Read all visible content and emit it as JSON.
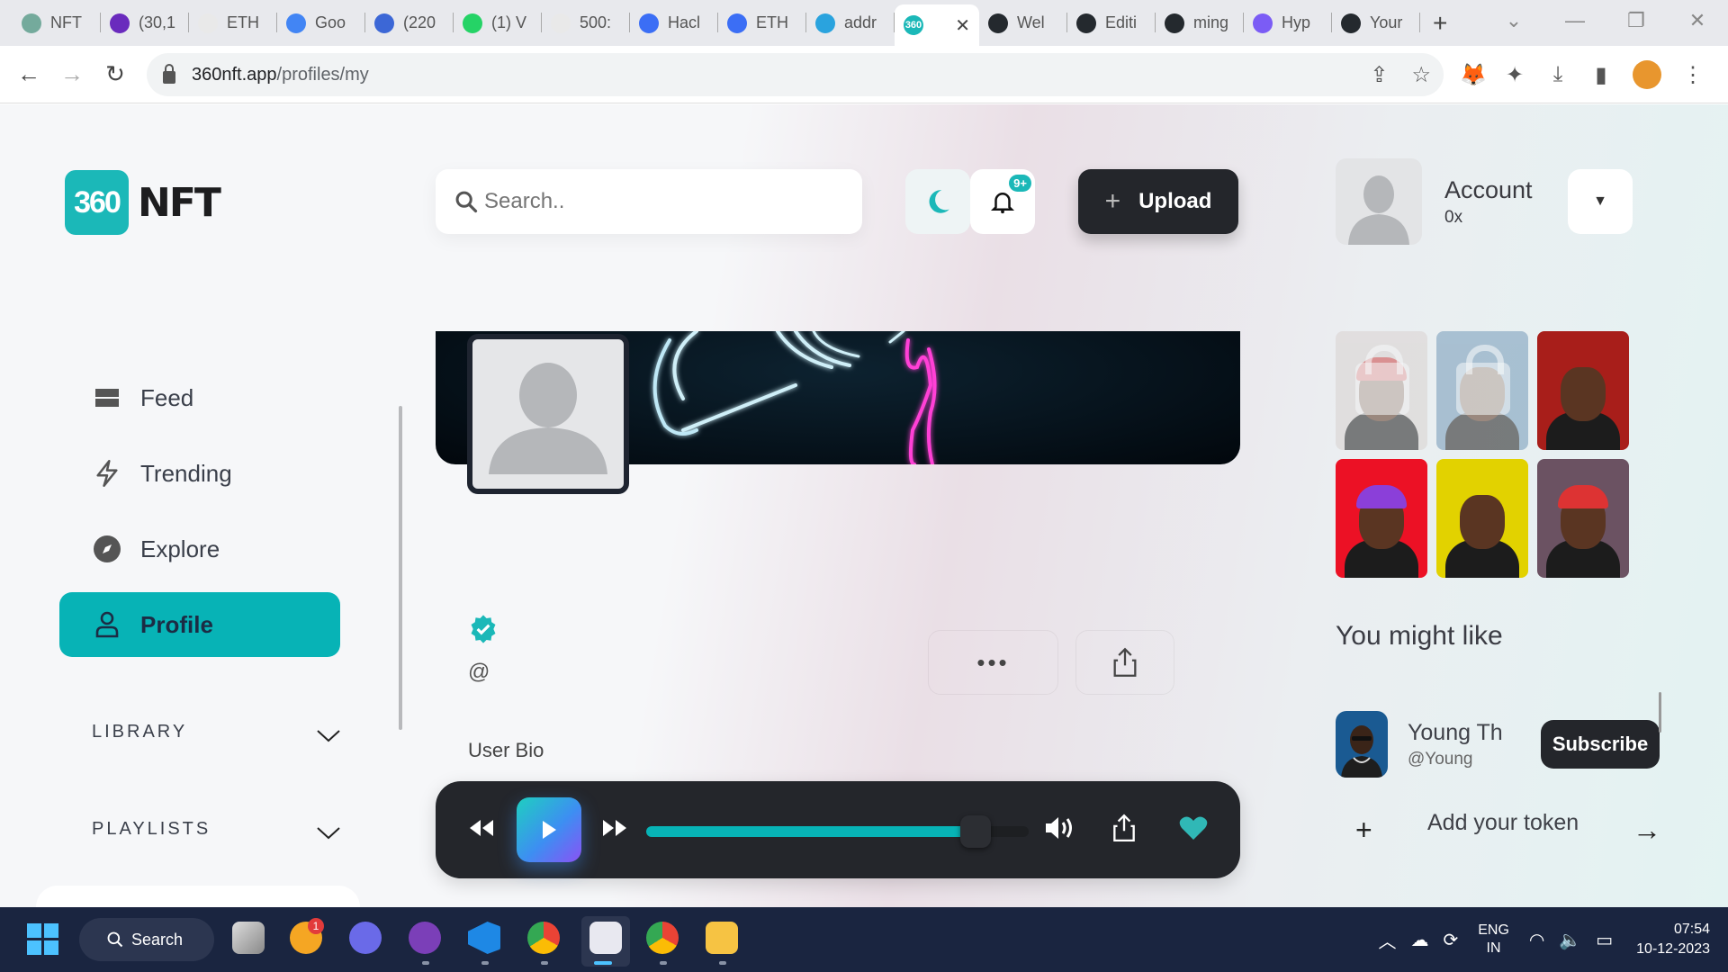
{
  "browser": {
    "tabs": [
      {
        "title": "NFT",
        "icon": "chatgpt-icon",
        "color": "#74aa9c"
      },
      {
        "title": "(30,1",
        "icon": "mail-icon",
        "color": "#6a2bbd"
      },
      {
        "title": "ETH",
        "icon": "eth-icon",
        "color": "#e9e9e9"
      },
      {
        "title": "Goo",
        "icon": "docs-icon",
        "color": "#4285f4"
      },
      {
        "title": "(220",
        "icon": "notification-icon",
        "color": "#3c67d6"
      },
      {
        "title": "(1) V",
        "icon": "whatsapp-icon",
        "color": "#25d366"
      },
      {
        "title": "500:",
        "icon": "eth-icon",
        "color": "#e9e9e9"
      },
      {
        "title": "Hacl",
        "icon": "doc-icon",
        "color": "#3b6ef5"
      },
      {
        "title": "ETH",
        "icon": "doc-icon",
        "color": "#3b6ef5"
      },
      {
        "title": "addr",
        "icon": "telegram-icon",
        "color": "#2aa3de"
      },
      {
        "title": "",
        "icon": "360nft-icon",
        "color": "#1bb8b8",
        "active": true
      },
      {
        "title": "Wel",
        "icon": "github-icon",
        "color": "#24292e"
      },
      {
        "title": "Editi",
        "icon": "github-icon",
        "color": "#24292e"
      },
      {
        "title": "ming",
        "icon": "github-icon",
        "color": "#24292e"
      },
      {
        "title": "Hyp",
        "icon": "hyper-icon",
        "color": "#7b5cf5"
      },
      {
        "title": "Your",
        "icon": "github-icon",
        "color": "#24292e"
      }
    ],
    "url_host": "360nft.app",
    "url_path": "/profiles/my"
  },
  "header": {
    "logo_number": "360",
    "logo_word": "NFT",
    "search_placeholder": "Search..",
    "notification_badge": "9+",
    "upload_label": "Upload",
    "account_name": "Account",
    "account_address": "0x"
  },
  "sidebar": {
    "items": [
      {
        "label": "Feed",
        "icon": "feed-icon"
      },
      {
        "label": "Trending",
        "icon": "lightning-icon"
      },
      {
        "label": "Explore",
        "icon": "compass-icon"
      },
      {
        "label": "Profile",
        "icon": "user-icon",
        "active": true
      }
    ],
    "sections": [
      {
        "label": "LIBRARY"
      },
      {
        "label": "PLAYLISTS"
      }
    ]
  },
  "profile": {
    "handle": "@",
    "bio": "User Bio",
    "more_label": "•••"
  },
  "nfts": [
    {
      "bg": "#d8d2d0",
      "locked": true,
      "hat": "#c44"
    },
    {
      "bg": "#7399b8",
      "locked": true,
      "hat": ""
    },
    {
      "bg": "#a81e1a",
      "locked": false,
      "hat": ""
    },
    {
      "bg": "#ec1125",
      "locked": false,
      "hat": "#8b3fd9"
    },
    {
      "bg": "#e2d200",
      "locked": false,
      "hat": ""
    },
    {
      "bg": "#6b5262",
      "locked": false,
      "hat": "#d33"
    }
  ],
  "suggestions": {
    "title": "You might like",
    "items": [
      {
        "name": "Young Th",
        "handle": "@Young",
        "action": "Subscribe"
      }
    ],
    "add_token_label": "Add your token"
  },
  "player": {
    "progress": 0.86,
    "accent": "#07b3b6",
    "liked": true
  },
  "taskbar": {
    "search_label": "Search",
    "mail_badge": "1",
    "lang_line1": "ENG",
    "lang_line2": "IN",
    "time": "07:54",
    "date": "10-12-2023"
  }
}
